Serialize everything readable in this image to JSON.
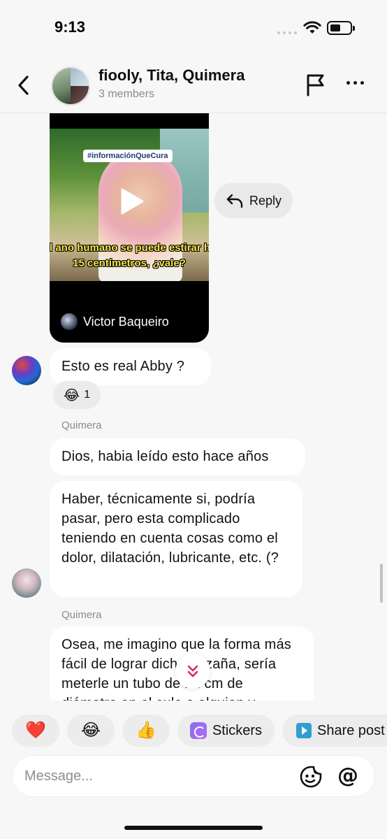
{
  "status_bar": {
    "time": "9:13"
  },
  "header": {
    "back_icon": "chevron-left-icon",
    "title": "fiooly, Tita, Quimera",
    "members": "3 members",
    "flag_icon": "flag-icon",
    "more_icon": "more-horizontal-icon"
  },
  "messages": {
    "video": {
      "tag": "#informaciónQueCura",
      "subtitle_line1": "l ano humano se puede estirar h",
      "subtitle_line2": "15 centímetros, ¿vale?",
      "author": "Victor Baqueiro"
    },
    "reply_label": "Reply",
    "m1": {
      "text": "Esto es real Abby ?",
      "reaction_emoji": "😂",
      "reaction_count": "1"
    },
    "sender_quimera_1": "Quimera",
    "m2": {
      "text": "Dios, habia leído esto hace años"
    },
    "m3": {
      "text": "Haber, técnicamente si, podría pasar, pero esta complicado teniendo en cuenta cosas como el dolor, dilatación, lubricante, etc. (?"
    },
    "sender_quimera_2": "Quimera",
    "m4": {
      "text": "Osea, me imagino que la forma más fácil de lograr dicha hazaña, sería meterle un tubo de 12 cm de diámetro en el culo a alguien y"
    }
  },
  "quick_actions": {
    "heart": "❤️",
    "laugh": "😂",
    "thumbs_up": "👍",
    "stickers": "Stickers",
    "share_post": "Share post"
  },
  "composer": {
    "placeholder": "Message..."
  }
}
